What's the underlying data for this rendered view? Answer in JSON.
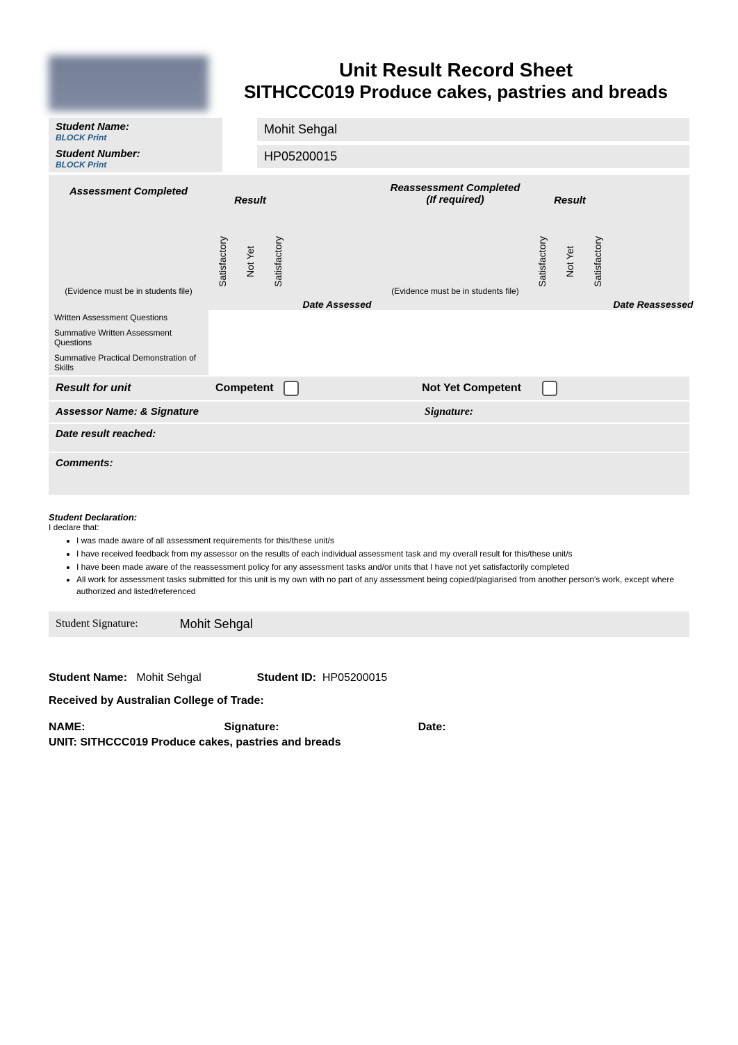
{
  "header": {
    "main_title": "Unit Result Record Sheet",
    "sub_title": "SITHCCC019 Produce cakes, pastries and breads"
  },
  "student": {
    "name_label": "Student Name:",
    "name_value": "Mohit Sehgal",
    "number_label": "Student Number:",
    "number_value": "HP05200015",
    "block_print": "BLOCK Print"
  },
  "table": {
    "assessment_completed": "Assessment Completed",
    "result": "Result",
    "reassessment_completed": "Reassessment Completed (If required)",
    "evidence_note": "(Evidence must be in students file)",
    "satisfactory": "Satisfactory",
    "not_yet_satisfactory_1": "Not Yet",
    "not_yet_satisfactory_2": "Satisfactory",
    "date_assessed": "Date Assessed",
    "date_reassessed": "Date Reassessed",
    "rows": [
      "Written Assessment Questions",
      "Summative Written Assessment Questions",
      "Summative Practical Demonstration of Skills"
    ]
  },
  "result_unit": {
    "label": "Result for unit",
    "competent": "Competent",
    "not_yet_competent": "Not Yet Competent"
  },
  "assessor": {
    "label": "Assessor Name: & Signature",
    "signature_label": "Signature:"
  },
  "date_result": {
    "label": "Date result reached:"
  },
  "comments": {
    "label": "Comments:"
  },
  "declaration": {
    "heading": "Student Declaration:",
    "intro": "I declare that:",
    "items": [
      "I was made aware of all assessment requirements for this/these unit/s",
      "I have received feedback from my assessor on the results of each individual assessment task and my overall result for this/these unit/s",
      "I have been made aware of the reassessment policy for any assessment tasks and/or units that I have not yet satisfactorily completed",
      "All work for assessment tasks submitted for this unit is my own with no part of any assessment being copied/plagiarised from another person's work, except where authorized and listed/referenced"
    ]
  },
  "student_signature": {
    "label": "Student Signature:",
    "value": "Mohit Sehgal"
  },
  "footer": {
    "student_name_label": "Student Name:",
    "student_name_value": "Mohit Sehgal",
    "student_id_label": "Student ID:",
    "student_id_value": "HP05200015",
    "received_by": "Received by Australian College of Trade:",
    "name_label": "NAME:",
    "signature_label": "Signature:",
    "date_label": "Date:",
    "unit_line": "UNIT: SITHCCC019 Produce cakes, pastries and breads"
  }
}
